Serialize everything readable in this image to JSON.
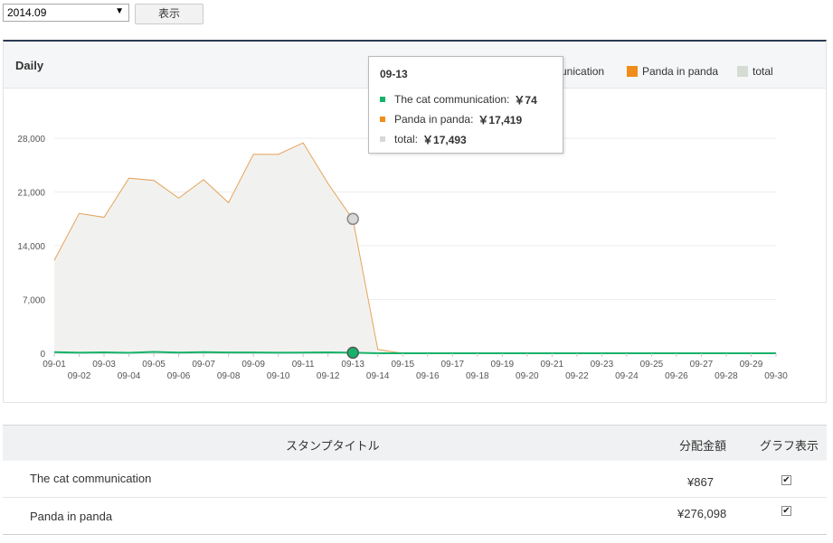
{
  "toolbar": {
    "month_value": "2014.09",
    "show_label": "表示"
  },
  "panel": {
    "title": "Daily"
  },
  "legend": {
    "items": [
      {
        "label": "unication",
        "color": "#17b26a"
      },
      {
        "label": "Panda in panda",
        "color": "#f08c1a"
      },
      {
        "label": "total",
        "color": "#d4dcd3"
      }
    ]
  },
  "tooltip": {
    "title": "09-13",
    "rows": [
      {
        "label": "The cat communication:",
        "value": "￥74",
        "color": "#17b26a"
      },
      {
        "label": "Panda in panda:",
        "value": "￥17,419",
        "color": "#f08c1a"
      },
      {
        "label": "total:",
        "value": "￥17,493",
        "color": "#d8d8d8"
      }
    ]
  },
  "chart_data": {
    "type": "area",
    "x": [
      "09-01",
      "09-02",
      "09-03",
      "09-04",
      "09-05",
      "09-06",
      "09-07",
      "09-08",
      "09-09",
      "09-10",
      "09-11",
      "09-12",
      "09-13",
      "09-14",
      "09-15",
      "09-16",
      "09-17",
      "09-18",
      "09-19",
      "09-20",
      "09-21",
      "09-22",
      "09-23",
      "09-24",
      "09-25",
      "09-26",
      "09-27",
      "09-28",
      "09-29",
      "09-30"
    ],
    "y_ticks": [
      "0",
      "7,000",
      "14,000",
      "21,000",
      "28,000"
    ],
    "ylim": [
      0,
      28000
    ],
    "series": [
      {
        "name": "The cat communication",
        "color": "#17b26a",
        "values": [
          150,
          80,
          120,
          60,
          180,
          90,
          140,
          110,
          100,
          70,
          90,
          120,
          74,
          0,
          0,
          0,
          0,
          0,
          0,
          0,
          0,
          0,
          0,
          0,
          0,
          0,
          0,
          0,
          0,
          0
        ]
      },
      {
        "name": "Panda in panda",
        "color": "#e8a35a",
        "values": [
          12100,
          18200,
          17700,
          22800,
          22500,
          20200,
          22600,
          19600,
          25900,
          25900,
          27400,
          22100,
          17419,
          500,
          0,
          0,
          0,
          0,
          0,
          0,
          0,
          0,
          0,
          0,
          0,
          0,
          0,
          0,
          0,
          0
        ]
      },
      {
        "name": "total",
        "color": "#d4dcd3",
        "values": [
          12250,
          18280,
          17820,
          22860,
          22680,
          20290,
          22740,
          19710,
          26000,
          25970,
          27490,
          22220,
          17493,
          500,
          0,
          0,
          0,
          0,
          0,
          0,
          0,
          0,
          0,
          0,
          0,
          0,
          0,
          0,
          0,
          0
        ]
      }
    ]
  },
  "table": {
    "headers": {
      "title": "スタンプタイトル",
      "amount": "分配金額",
      "graph": "グラフ表示"
    },
    "rows": [
      {
        "title": "The cat communication",
        "amount": "¥867",
        "checked": "✔"
      },
      {
        "title": "Panda in panda",
        "amount": "¥276,098",
        "checked": "✔"
      }
    ]
  }
}
